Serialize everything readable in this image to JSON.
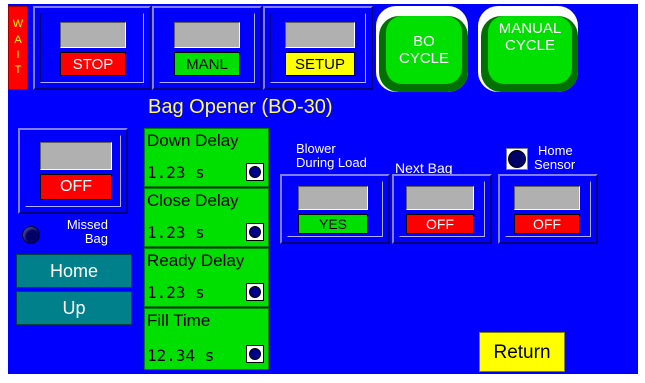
{
  "wait_indicator": {
    "label": "W A I T",
    "letters": [
      "W",
      "A",
      "I",
      "T"
    ]
  },
  "top_buttons": {
    "stop": "STOP",
    "manual": "MANL",
    "setup": "SETUP",
    "bo_cycle": [
      "BO",
      "CYCLE"
    ],
    "manual_cycle": [
      "MANUAL",
      "CYCLE"
    ]
  },
  "title": "Bag Opener (BO-30)",
  "main_toggle": {
    "state": "OFF"
  },
  "missed_bag": {
    "label_line1": "Missed",
    "label_line2": "Bag"
  },
  "nav": {
    "home": "Home",
    "up": "Up"
  },
  "timers": [
    {
      "label": "Down Delay",
      "value": "1.23 s"
    },
    {
      "label": "Close Delay",
      "value": "1.23 s"
    },
    {
      "label": "Ready Delay",
      "value": "1.23 s"
    },
    {
      "label": "Fill Time",
      "value": "12.34 s"
    }
  ],
  "blower": {
    "label_line1": "Blower",
    "label_line2": "During Load",
    "state": "YES"
  },
  "next_bag": {
    "label": "Next Bag",
    "state": "OFF"
  },
  "home_sensor": {
    "label_line1": "Home",
    "label_line2": "Sensor",
    "state": "OFF"
  },
  "return_button": "Return",
  "colors": {
    "background": "#0000ff",
    "on_green": "#00e000",
    "off_red": "#ff0000",
    "title_yellow": "#ffff55",
    "wait_red": "#ff0000",
    "return_yellow": "#ffff00",
    "nav_teal": "#00808a"
  }
}
